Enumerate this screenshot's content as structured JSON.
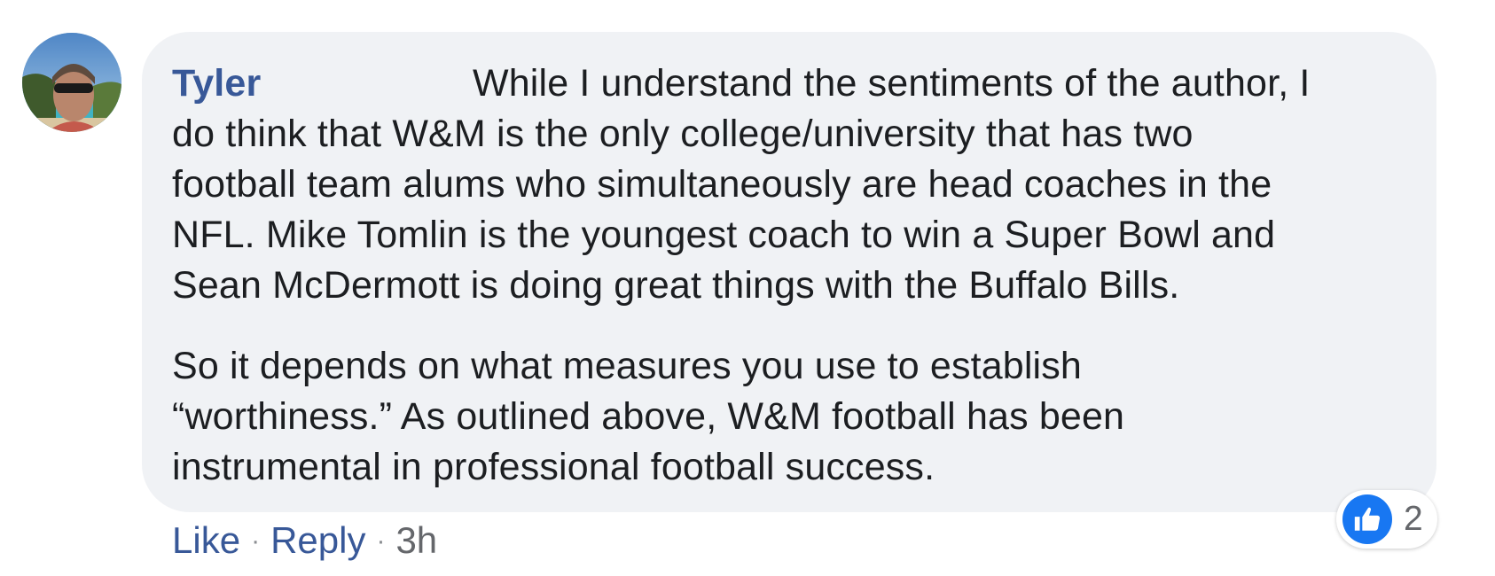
{
  "comment": {
    "author": "Tyler",
    "paragraph1_lines": [
      "While I understand the sentiments of the author, I",
      "do think that W&M is the only college/university that has two",
      "football team alums who simultaneously are head coaches in the",
      "NFL. Mike Tomlin is the youngest coach to win a Super Bowl and",
      "Sean McDermott is doing great things with the Buffalo Bills."
    ],
    "paragraph2_lines": [
      "So it depends on what measures you use to establish",
      "“worthiness.” As outlined above, W&M football has been",
      "instrumental in professional football success."
    ]
  },
  "actions": {
    "like": "Like",
    "separator": "·",
    "reply": "Reply",
    "time": "3h"
  },
  "reactions": {
    "icon": "thumbs-up-icon",
    "count": "2"
  },
  "colors": {
    "author": "#385898",
    "bubble_bg": "#f0f2f5",
    "like_blue": "#1877f2",
    "text": "#1c1e21"
  }
}
